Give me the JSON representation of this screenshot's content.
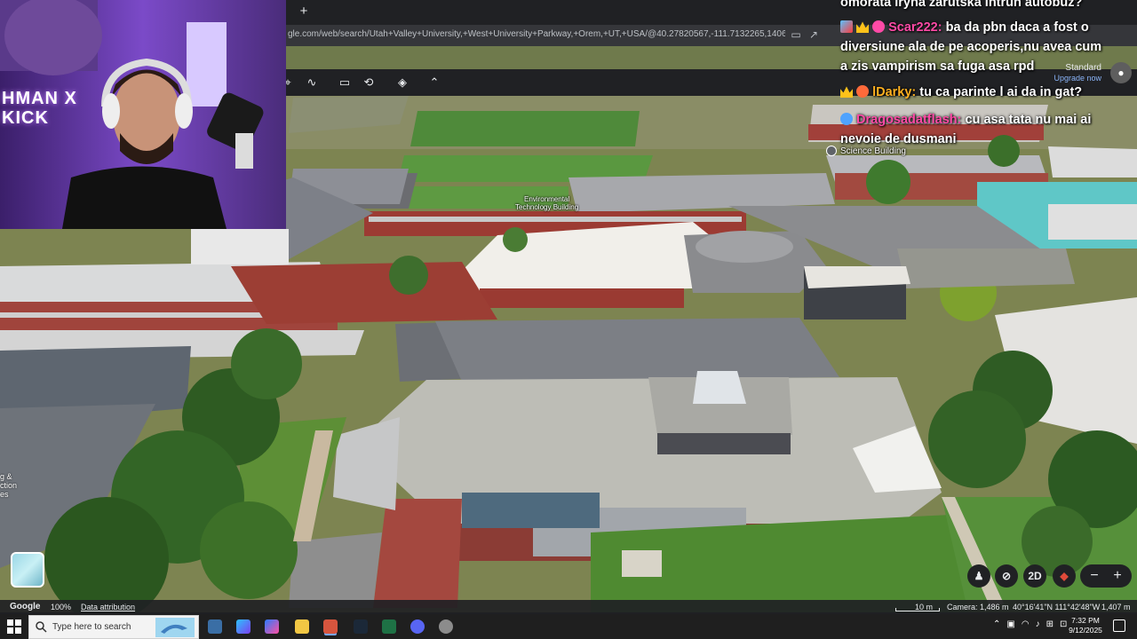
{
  "browser": {
    "new_tab_label": "+",
    "url": "gle.com/web/search/Utah+Valley+University,+West+University+Parkway,+Orem,+UT,+USA/@40.27820567,-111.7132265,1406.87351...",
    "window_controls": [
      "–",
      "▢",
      "✕"
    ]
  },
  "webcam": {
    "overlay_text": "HMAN X KICK"
  },
  "chat": {
    "lines": [
      {
        "user": "",
        "message": "omorata iryna zarutska intrun autobuz?"
      },
      {
        "user": "Scar222:",
        "message": " ba da pbn daca a fost o"
      },
      {
        "user": "",
        "message": "diversiune ala de pe acoperis,nu avea cum"
      },
      {
        "user": "",
        "message": "a zis vampirism sa fuga asa rpd"
      },
      {
        "user": "lDarky:",
        "message": " tu ca parinte l ai da in gat?"
      },
      {
        "user": "Dragosadatflash:",
        "message": " cu asa tata nu mai ai"
      },
      {
        "user": "",
        "message": "nevoie de dusmani"
      }
    ]
  },
  "plan": {
    "name": "Standard",
    "upgrade": "Upgrade now"
  },
  "map_labels": {
    "environmental": "Environmental\nTechnology Building",
    "science": "Science Building",
    "edge_text": "g &\nction\nes"
  },
  "controls": {
    "mode_2d": "2D",
    "zoom_out": "−",
    "zoom_in": "+"
  },
  "status": {
    "brand": "Google",
    "zoom": "100%",
    "attribution": "Data attribution",
    "scale": "10 m",
    "camera": "Camera: 1,486 m",
    "coords": "40°16'41\"N 111°42'48\"W",
    "elevation": "1,407 m"
  },
  "taskbar": {
    "search_placeholder": "Type here to search",
    "time": "7:32 PM",
    "date": "9/12/2025"
  }
}
